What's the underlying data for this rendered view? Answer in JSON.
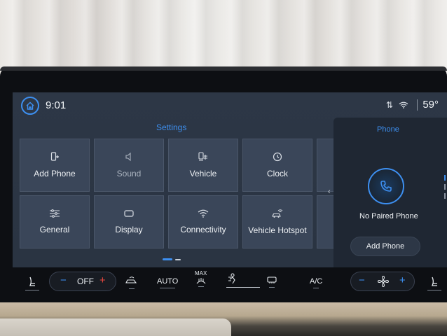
{
  "status_bar": {
    "time": "9:01",
    "temperature": "59°",
    "signal_glyph": "⇅"
  },
  "settings": {
    "title": "Settings",
    "tiles": [
      {
        "label": "Add Phone",
        "icon": "phone-add-icon"
      },
      {
        "label": "Sound",
        "icon": "speaker-icon"
      },
      {
        "label": "Vehicle",
        "icon": "vehicle-settings-icon"
      },
      {
        "label": "Clock",
        "icon": "clock-icon"
      },
      {
        "label": "General",
        "icon": "sliders-icon"
      },
      {
        "label": "Display",
        "icon": "display-icon"
      },
      {
        "label": "Connectivity",
        "icon": "wifi-icon"
      },
      {
        "label": "Vehicle Hotspot",
        "icon": "car-wifi-icon"
      }
    ]
  },
  "phone_panel": {
    "title": "Phone",
    "status": "No Paired Phone",
    "add_button": "Add Phone",
    "chevron": "‹"
  },
  "climate": {
    "left_minus": "−",
    "left_mode": "OFF",
    "left_plus": "+",
    "auto": "AUTO",
    "max": "MAX",
    "ac": "A/C",
    "right_minus": "−",
    "right_plus": "+"
  },
  "colors": {
    "accent": "#3d8ff0",
    "screen_bg": "#2d3746",
    "tile_bg": "#3a4659",
    "heat": "#e8473f"
  }
}
